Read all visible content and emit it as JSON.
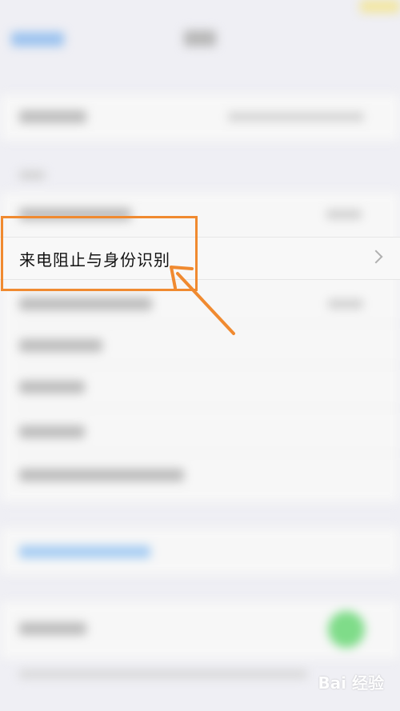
{
  "settings_row": {
    "label": "来电阻止与身份识别"
  },
  "icons": {
    "row_chevron": "chevron-right-icon"
  },
  "colors": {
    "highlight": "#f08a30",
    "background": "#efeff4",
    "toggle_on": "#4cd964",
    "link_blue": "#2f80ed"
  },
  "watermark": {
    "text": "Bai 经验"
  }
}
